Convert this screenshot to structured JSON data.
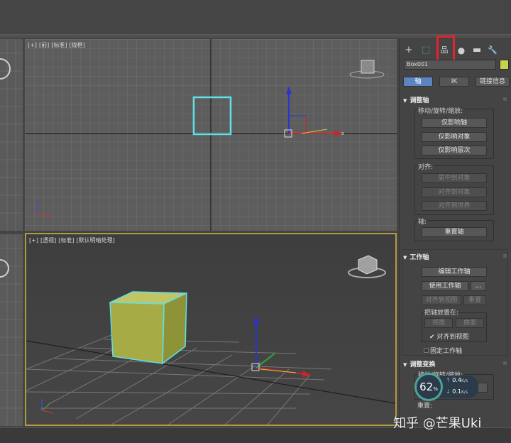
{
  "viewports": {
    "front": {
      "labels": [
        "[+]",
        "[前]",
        "[标准]",
        "[线框]"
      ]
    },
    "perspective": {
      "labels": [
        "[+]",
        "[透视]",
        "[标准]",
        "[默认明暗处理]"
      ]
    }
  },
  "panel": {
    "tabs": [
      {
        "icon": "create-plus-icon",
        "glyph": "+"
      },
      {
        "icon": "modify-icon",
        "glyph": "⬚"
      },
      {
        "icon": "hierarchy-icon",
        "glyph": "品"
      },
      {
        "icon": "motion-icon",
        "glyph": "●"
      },
      {
        "icon": "display-icon",
        "glyph": "▬"
      },
      {
        "icon": "utilities-icon",
        "glyph": "🔧"
      }
    ],
    "object_name": "Box001",
    "object_color": "#c7d34c",
    "mode_buttons": {
      "pivot": "轴",
      "ik": "IK",
      "link_info": "链接信息"
    },
    "adjust_pivot": {
      "title": "调整轴",
      "move_group": "移动/旋转/缩放:",
      "affect_pivot_only": "仅影响轴",
      "affect_object_only": "仅影响对象",
      "affect_hierarchy_only": "仅影响层次",
      "align_group": "对齐:",
      "center_to_object": "居中到对象",
      "align_to_object": "对齐到对象",
      "align_to_world": "对齐到世界",
      "pivot_group": "轴:",
      "reset_pivot": "重置轴"
    },
    "working_pivot": {
      "title": "工作轴",
      "edit_working_pivot": "编辑工作轴",
      "use_working_pivot": "使用工作轴",
      "more": "...",
      "align_to_view": "对齐到视图",
      "reset": "重置",
      "place_pivot_group": "把轴放置在:",
      "view": "视图",
      "surface": "曲面",
      "align_to_view_check": "对齐到视图",
      "lock_working_pivot": "固定工作轴"
    },
    "adjust_transform": {
      "title": "调整变换",
      "move_group": "移动/旋转/缩放:",
      "reset_group": "重置:"
    }
  },
  "speed_widget": {
    "percent": "62",
    "percent_unit": "%",
    "up": "0.4",
    "down": "0.1",
    "unit": "K/s"
  },
  "watermark": "知乎 @芒果Uki"
}
